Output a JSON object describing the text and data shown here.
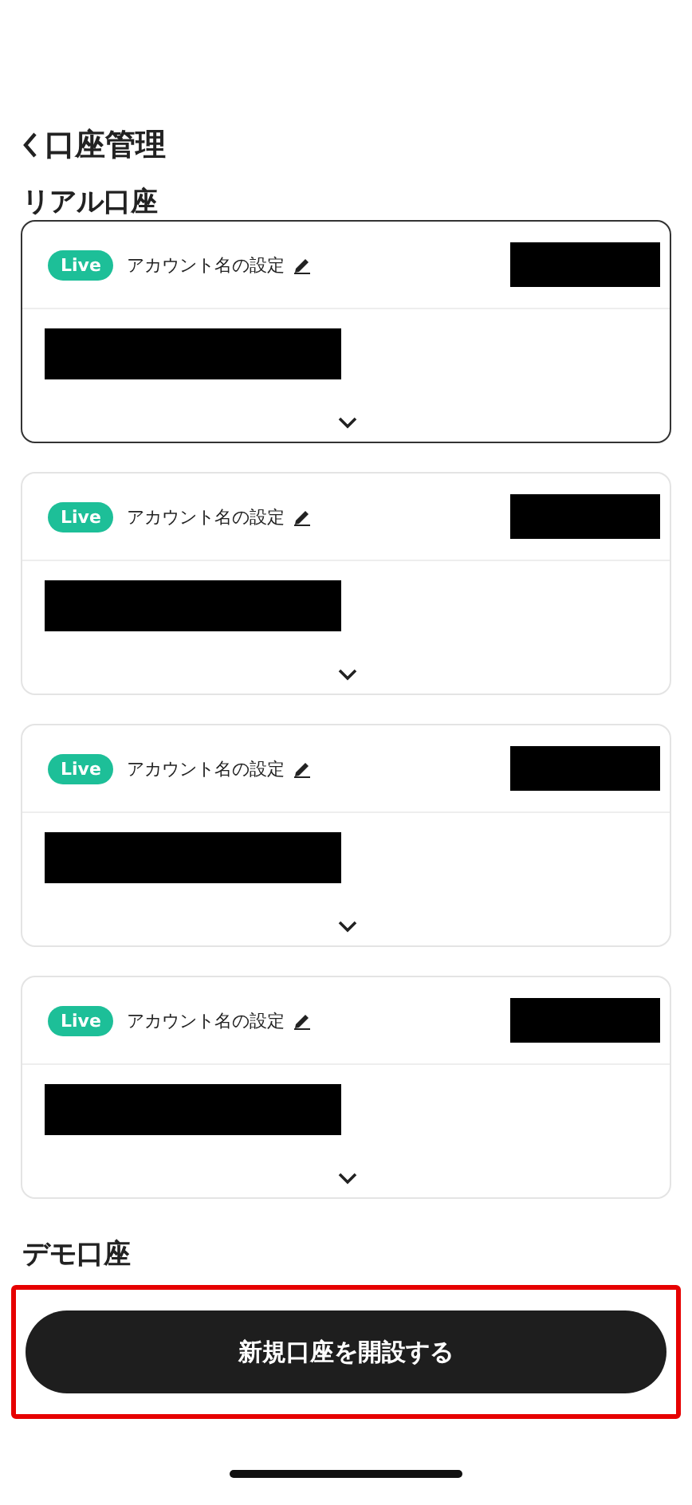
{
  "header": {
    "title": "口座管理"
  },
  "sections": [
    {
      "title": "リアル口座",
      "accounts": [
        {
          "badge": "Live",
          "name_label": "アカウント名の設定",
          "selected": true
        },
        {
          "badge": "Live",
          "name_label": "アカウント名の設定",
          "selected": false
        },
        {
          "badge": "Live",
          "name_label": "アカウント名の設定",
          "selected": false
        },
        {
          "badge": "Live",
          "name_label": "アカウント名の設定",
          "selected": false
        }
      ]
    },
    {
      "title": "デモ口座"
    }
  ],
  "open_account_button": {
    "label": "新規口座を開設する",
    "highlighted": true
  }
}
